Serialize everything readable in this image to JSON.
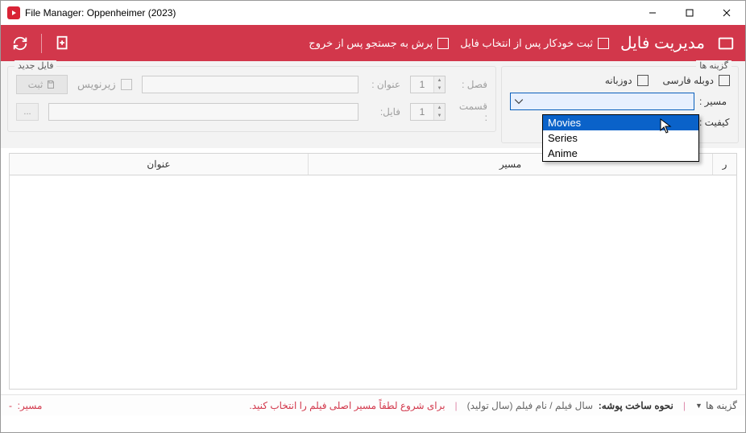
{
  "window": {
    "title": "File Manager: Oppenheimer (2023)"
  },
  "toolbar": {
    "app_title": "مدیریت فایل",
    "chk_autosave": "ثبت خودکار پس از انتخاب فایل",
    "chk_jump": "پرش به جستجو پس از خروج"
  },
  "options": {
    "legend": "گزینه ها",
    "chk_dub": "دوبله فارسی",
    "chk_bilingual": "دوزبانه",
    "lbl_path": "مسیر :",
    "lbl_quality": "کیفیت :",
    "dropdown": {
      "items": [
        "Movies",
        "Series",
        "Anime"
      ],
      "selected_index": 0
    }
  },
  "newfile": {
    "legend": "فایل جدید",
    "lbl_season": "فصل :",
    "lbl_episode": "قسمت :",
    "lbl_title": "عنوان :",
    "lbl_file": "فایل:",
    "chk_subtitle": "زیرنویس",
    "btn_submit": "ثبت",
    "spin_season": "1",
    "spin_episode": "1",
    "btn_browse": "..."
  },
  "grid": {
    "col_row": "ر",
    "col_path": "مسیر",
    "col_title": "عنوان"
  },
  "status": {
    "options": "گزینه ها",
    "folder_label": "نحوه ساخت پوشه:",
    "folder_value": "سال فیلم / نام فیلم (سال تولید)",
    "warn": "برای شروع لطفاً مسیر اصلی فیلم را انتخاب کنید.",
    "path_label": "مسیر:",
    "path_value": "-"
  }
}
